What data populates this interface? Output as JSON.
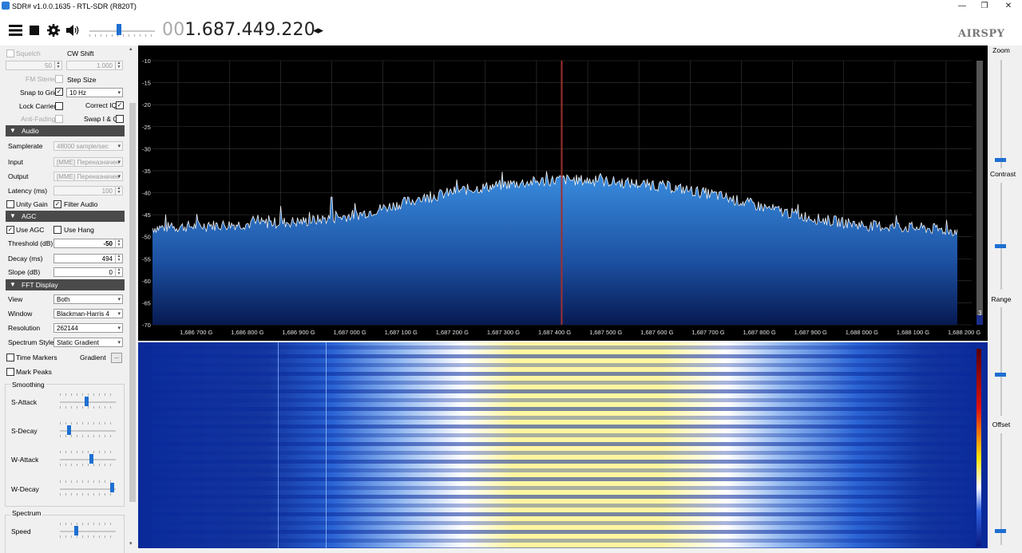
{
  "window": {
    "title": "SDR# v1.0.0.1635 - RTL-SDR (R820T)",
    "controls": [
      "—",
      "❐",
      "✕"
    ]
  },
  "toolbar": {
    "frequency_dim": "00",
    "frequency": "1.687.449.220",
    "arrows": "◂▸",
    "logo": "AIRSPY"
  },
  "radio": {
    "squelch_label": "Squelch",
    "squelch_value": "50",
    "cw_shift_label": "CW Shift",
    "cw_shift_value": "1.000",
    "fm_stereo_label": "FM Stereo",
    "step_size_label": "Step Size",
    "snap_label": "Snap to Grid",
    "step_value": "10 Hz",
    "lock_carrier_label": "Lock Carrier",
    "correct_iq_label": "Correct IQ",
    "anti_fading_label": "Anti-Fading",
    "swap_iq_label": "Swap I & Q"
  },
  "audio": {
    "header": "Audio",
    "samplerate_label": "Samplerate",
    "samplerate_value": "48000 sample/sec",
    "input_label": "Input",
    "input_value": "[MME] Переназначен",
    "output_label": "Output",
    "output_value": "[MME] Переназначен",
    "latency_label": "Latency (ms)",
    "latency_value": "100",
    "unity_gain_label": "Unity Gain",
    "filter_audio_label": "Filter Audio"
  },
  "agc": {
    "header": "AGC",
    "use_agc_label": "Use AGC",
    "use_hang_label": "Use Hang",
    "threshold_label": "Threshold (dB)",
    "threshold_value": "-50",
    "decay_label": "Decay (ms)",
    "decay_value": "494",
    "slope_label": "Slope (dB)",
    "slope_value": "0"
  },
  "fft": {
    "header": "FFT Display",
    "view_label": "View",
    "view_value": "Both",
    "window_label": "Window",
    "window_value": "Blackman-Harris 4",
    "resolution_label": "Resolution",
    "resolution_value": "262144",
    "style_label": "Spectrum Style",
    "style_value": "Static Gradient",
    "time_markers_label": "Time Markers",
    "gradient_label": "Gradient",
    "gradient_btn": "...",
    "mark_peaks_label": "Mark Peaks",
    "smoothing_label": "Smoothing",
    "s_attack_label": "S-Attack",
    "s_decay_label": "S-Decay",
    "w_attack_label": "W-Attack",
    "w_decay_label": "W-Decay",
    "spectrum_label": "Spectrum",
    "speed_label": "Speed"
  },
  "right_panel": {
    "zoom": "Zoom",
    "contrast": "Contrast",
    "range": "Range",
    "offset": "Offset"
  },
  "spectrum": {
    "y_ticks": [
      "-10",
      "-15",
      "-20",
      "-25",
      "-30",
      "-35",
      "-40",
      "-45",
      "-50",
      "-55",
      "-60",
      "-65",
      "-70"
    ],
    "x_ticks": [
      "1,686 700 G",
      "1,686 800 G",
      "1,686 900 G",
      "1,687 000 G",
      "1,687 100 G",
      "1,687 200 G",
      "1,687 300 G",
      "1,687 400 G",
      "1,687 500 G",
      "1,687 600 G",
      "1,687 700 G",
      "1,687 800 G",
      "1,687 900 G",
      "1,688 000 G",
      "1,688 100 G",
      "1,688 200 G"
    ],
    "level_marker": "3"
  },
  "chart_data": {
    "type": "area",
    "x_unit": "GHz",
    "xlim": [
      1.68665,
      1.68825
    ],
    "ylim": [
      -70,
      -10
    ],
    "x": [
      1.68665,
      1.68675,
      1.68685,
      1.68695,
      1.68705,
      1.68715,
      1.68725,
      1.68735,
      1.68745,
      1.68755,
      1.68765,
      1.68775,
      1.68785,
      1.68795,
      1.68805,
      1.68815,
      1.68825
    ],
    "values": [
      -48,
      -47.5,
      -47,
      -46.5,
      -45,
      -42,
      -39.5,
      -38,
      -37,
      -37.5,
      -38.5,
      -40.5,
      -43.5,
      -46,
      -47.5,
      -48,
      -49
    ],
    "spikes": [
      {
        "x": 1.6869,
        "value": -43
      },
      {
        "x": 1.687,
        "value": -41
      }
    ],
    "tuned_frequency": 1.68744922
  },
  "colors": {
    "accent": "#1e6fd2",
    "section_header": "#4a4a4a",
    "marker": "#a03030",
    "waterfall_hot": "#fff6a0"
  }
}
